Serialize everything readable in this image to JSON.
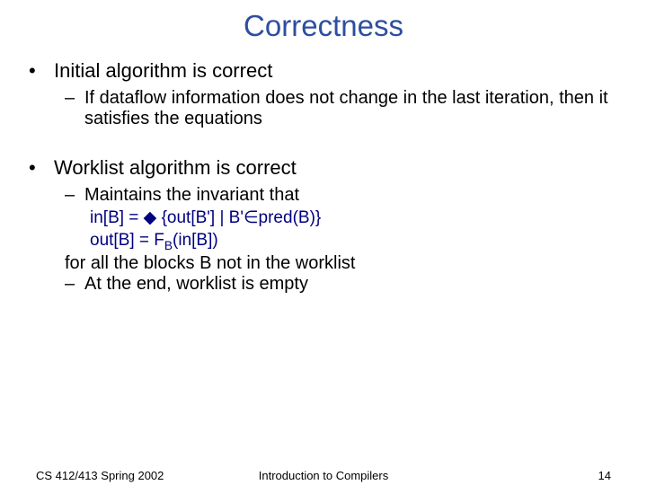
{
  "title": "Correctness",
  "bullet1": "Initial algorithm is correct",
  "sub1": "If dataflow information does not change in the last iteration, then it satisfies the equations",
  "bullet2": "Worklist algorithm is correct",
  "sub2": "Maintains the invariant that",
  "formula1_pre": "in[B] = ",
  "formula1_post": " {out[B'] | B'∈pred(B)}",
  "formula2_pre": "out[B] = F",
  "formula2_sub": "B",
  "formula2_post": "(in[B])",
  "afterFormula": "for all the blocks B not in the worklist",
  "sub3": "At the end, worklist is empty",
  "footer": {
    "left": "CS 412/413   Spring 2002",
    "center": "Introduction to Compilers",
    "right": "14"
  }
}
